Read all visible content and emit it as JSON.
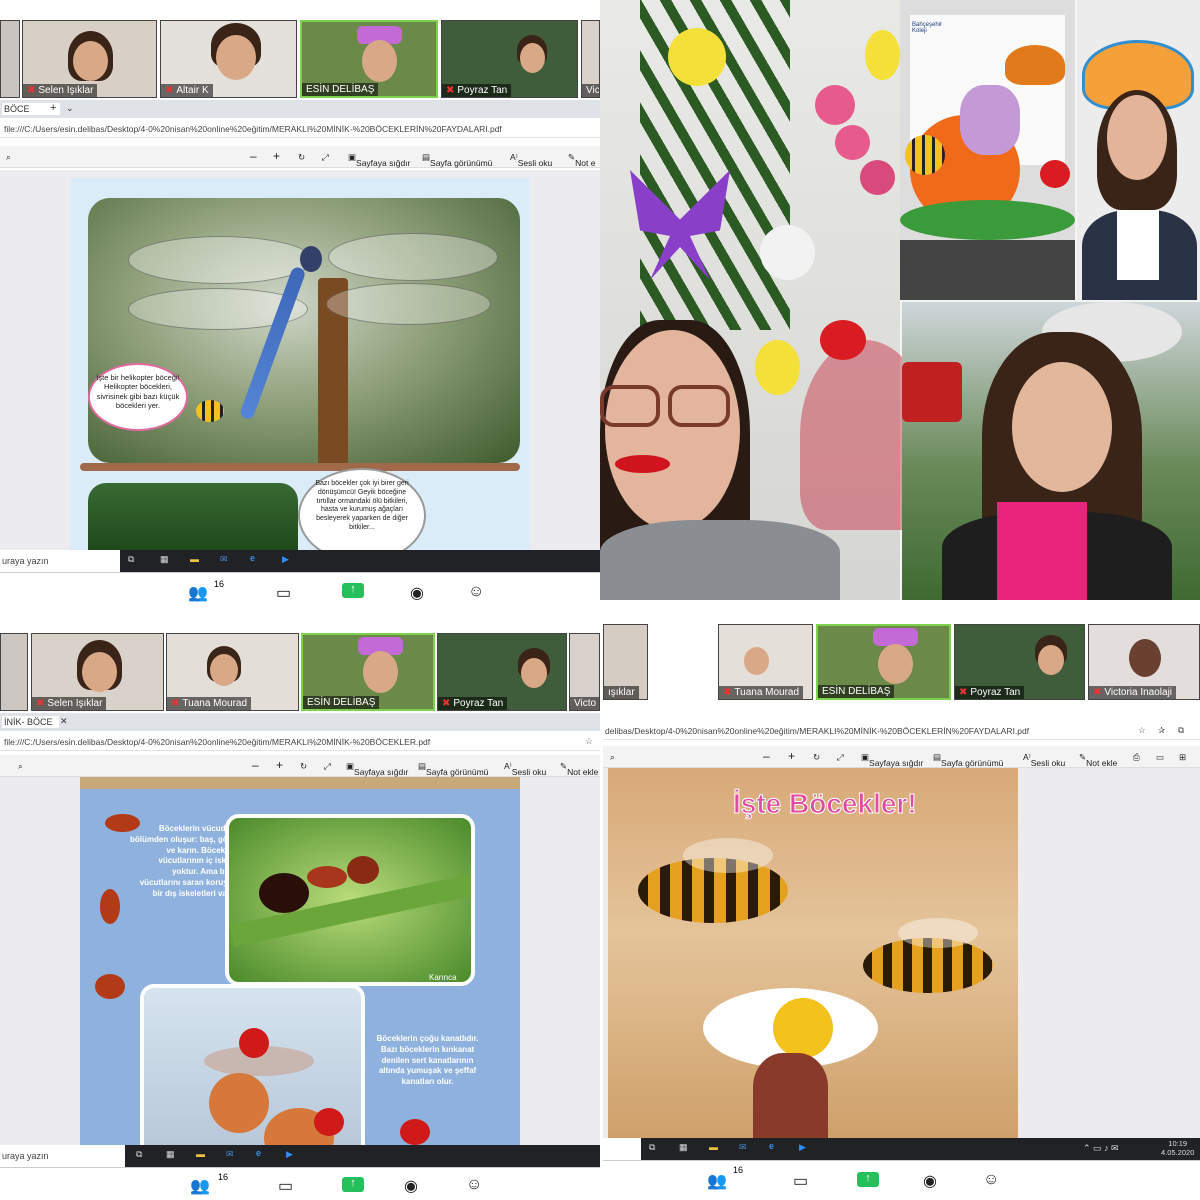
{
  "panel_tl": {
    "participants": [
      {
        "name": "Selen Işıklar"
      },
      {
        "name": "Altair K"
      },
      {
        "name": "ESİN DELİBAŞ"
      },
      {
        "name": "Poyraz Tan"
      },
      {
        "name": "Victo"
      }
    ],
    "tab_label": "BÖCE",
    "address": "file:///C:/Users/esin.delibas/Desktop/4-0%20nisan%20online%20eğitim/MERAKLI%20MİNİK-%20BÖCEKLERİN%20FAYDALARI.pdf",
    "toolbar": {
      "fit": "Sayfaya sığdır",
      "view": "Sayfa görünümü",
      "read": "Sesli oku",
      "note": "Not e"
    },
    "bubble1": "İşte bir helikopter böceği! Helikopter böcekleri, sivrisinek gibi bazı küçük böcekleri yer.",
    "bubble2": "Bazı böcekler çok iyi birer geri dönüşümcü! Geyik böceğine tırtıllar ormandaki ölü bitkileri, hasta ve kurumuş ağaçları besleyerek yaparken de diğer bitkiler...",
    "search_placeholder": "uraya yazın",
    "participant_count": "16"
  },
  "panel_tr": {
    "sign_text": "Bahçeşehir Koleji"
  },
  "panel_bl": {
    "participants": [
      {
        "name": "Selen Işıklar"
      },
      {
        "name": "Tuana Mourad"
      },
      {
        "name": "ESİN DELİBAŞ"
      },
      {
        "name": "Poyraz Tan"
      },
      {
        "name": "Victo"
      }
    ],
    "tab_label": "İNİK- BÖCE",
    "address": "file:///C:/Users/esin.delibas/Desktop/4-0%20nisan%20online%20eğitim/MERAKLI%20MİNİK-%20BÖCEKLER.pdf",
    "toolbar": {
      "fit": "Sayfaya sığdır",
      "view": "Sayfa görünümü",
      "read": "Sesli oku",
      "note": "Not ekle"
    },
    "text1": "Böceklerin vücudu üç bölümden oluşur: baş, göğüs ve karın. Böceklerin vücutlarının iç iskeleti yoktur. Ama bütün vücutlarını saran koruyucu bir dış iskeletleri vardır.",
    "caption1": "Karınca",
    "text2": "Böceklerin çoğu kanatlıdır. Bazı böceklerin kınkanat denilen sert kanatlarının altında yumuşak ve şeffaf kanatları olur.",
    "search_placeholder": "uraya yazın",
    "participant_count": "16"
  },
  "panel_br": {
    "participants": [
      {
        "name": "ışıklar"
      },
      {
        "name": "Tuana Mourad"
      },
      {
        "name": "ESİN DELİBAŞ"
      },
      {
        "name": "Poyraz Tan"
      },
      {
        "name": "Victoria Inaolaji"
      }
    ],
    "address": "delibas/Desktop/4-0%20nisan%20online%20eğitim/MERAKLI%20MİNİK-%20BÖCEKLERİN%20FAYDALARI.pdf",
    "toolbar": {
      "fit": "Sayfaya sığdır",
      "view": "Sayfa görünümü",
      "read": "Sesli oku",
      "note": "Not ekle"
    },
    "title": "İşte Böcekler!",
    "time": "10:19",
    "date": "4.05.2020",
    "participant_count": "16"
  }
}
